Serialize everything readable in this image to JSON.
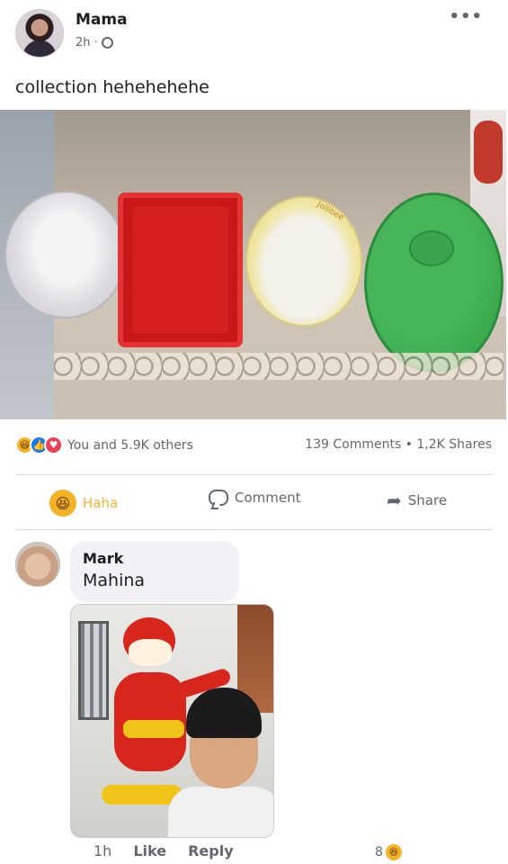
{
  "post": {
    "author": "Mama",
    "time": "2h",
    "separator": "·",
    "caption": "collection hehehehehe",
    "more_label": "•••"
  },
  "photo_label": "Jollibee",
  "engagement": {
    "reactions_text": "You and 5.9K others",
    "comments_shares": "139 Comments • 1,2K Shares"
  },
  "actions": {
    "haha": "Haha",
    "comment": "Comment",
    "share": "Share"
  },
  "comment": {
    "author": "Mark",
    "text": "Mahina",
    "time": "1h",
    "like": "Like",
    "reply": "Reply",
    "reaction_count": "8"
  },
  "colors": {
    "haha": "#f7b125",
    "like": "#1877f2",
    "love": "#f33e58",
    "muted_text": "#65676b"
  }
}
